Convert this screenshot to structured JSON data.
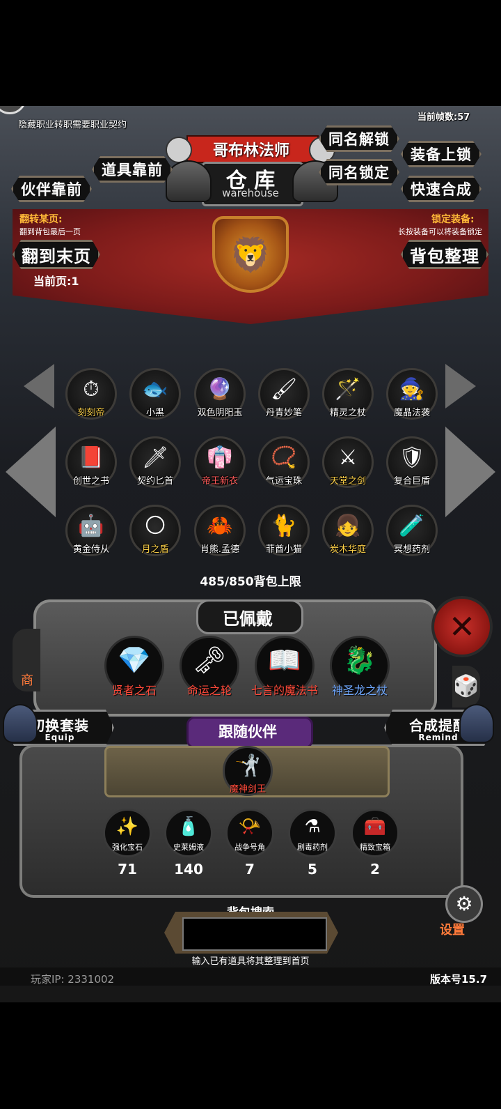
{
  "hud": {
    "hidden_job_hint": "隐藏职业转职需要职业契约",
    "fps": "当前帧数:57",
    "job_name": "哥布林法师",
    "title_cn": "仓 库",
    "title_en": "warehouse"
  },
  "buttons": {
    "same_name_unlock": "同名解锁",
    "same_name_lock": "同名锁定",
    "equip_lock": "装备上锁",
    "quick_merge": "快速合成",
    "item_front": "道具靠前",
    "partner_front": "伙伴靠前",
    "to_last_page": "翻到末页",
    "sort_bag": "背包整理",
    "switch_set": "切换套装",
    "switch_set_en": "Equip",
    "merge_remind": "合成提醒",
    "merge_remind_en": "Remind",
    "follow_partner": "跟随伙伴",
    "settings": "设置"
  },
  "hints": {
    "flip_page_title": "翻转某页:",
    "flip_page_desc": "翻到背包最后一页",
    "lock_equip_title": "锁定装备:",
    "lock_equip_desc": "长按装备可以将装备锁定",
    "current_page": "当前页:1"
  },
  "inventory": [
    {
      "name": "刻刻帝",
      "icon": "⏱",
      "color": "gold"
    },
    {
      "name": "小黑",
      "icon": "🐟",
      "color": "white"
    },
    {
      "name": "双色阴阳玉",
      "icon": "🔮",
      "color": "white"
    },
    {
      "name": "丹青妙笔",
      "icon": "🖌",
      "color": "white"
    },
    {
      "name": "精灵之杖",
      "icon": "🪄",
      "color": "white"
    },
    {
      "name": "魔晶法袭",
      "icon": "🧙",
      "color": "white"
    },
    {
      "name": "创世之书",
      "icon": "📕",
      "color": "white"
    },
    {
      "name": "契约匕首",
      "icon": "🗡",
      "color": "white"
    },
    {
      "name": "帝王新衣",
      "icon": "👘",
      "color": "red"
    },
    {
      "name": "气运宝珠",
      "icon": "📿",
      "color": "white"
    },
    {
      "name": "天堂之剑",
      "icon": "⚔",
      "color": "gold"
    },
    {
      "name": "复合巨盾",
      "icon": "🛡",
      "color": "white"
    },
    {
      "name": "黄金侍从",
      "icon": "🤖",
      "color": "white"
    },
    {
      "name": "月之盾",
      "icon": "🌕",
      "color": "gold"
    },
    {
      "name": "肖熊.孟德",
      "icon": "🦀",
      "color": "white"
    },
    {
      "name": "菲酋小猫",
      "icon": "🐈",
      "color": "white"
    },
    {
      "name": "炭木华庭",
      "icon": "👧",
      "color": "gold"
    },
    {
      "name": "冥想药剂",
      "icon": "🧪",
      "color": "white"
    }
  ],
  "bag_limit": "485/850背包上限",
  "equipped": {
    "title": "已佩戴",
    "items": [
      {
        "name": "贤者之石",
        "icon": "💎"
      },
      {
        "name": "命运之轮",
        "icon": "🗝"
      },
      {
        "name": "七言的魔法书",
        "icon": "📖"
      },
      {
        "name": "神圣龙之杖",
        "icon": "🐉"
      }
    ]
  },
  "partner": {
    "name": "魔神剑王",
    "icon": "🤺"
  },
  "consumables": [
    {
      "name": "强化宝石",
      "icon": "✨",
      "count": "71"
    },
    {
      "name": "史莱姆液",
      "icon": "🧴",
      "count": "140"
    },
    {
      "name": "战争号角",
      "icon": "📯",
      "count": "7"
    },
    {
      "name": "剧毒药剂",
      "icon": "⚗",
      "count": "5"
    },
    {
      "name": "精致宝箱",
      "icon": "🧰",
      "count": "2"
    }
  ],
  "search": {
    "title": "背包搜索",
    "value": "",
    "hint": "输入已有道具将其整理到首页"
  },
  "footer": {
    "player_ip": "玩家IP:  2331002",
    "version": "版本号15.7"
  },
  "side": {
    "shop_partial": "商"
  },
  "colors": {
    "banner_red": "#8c1f1c",
    "gold_text": "#ffb938",
    "name_red": "#ff4a3a"
  }
}
